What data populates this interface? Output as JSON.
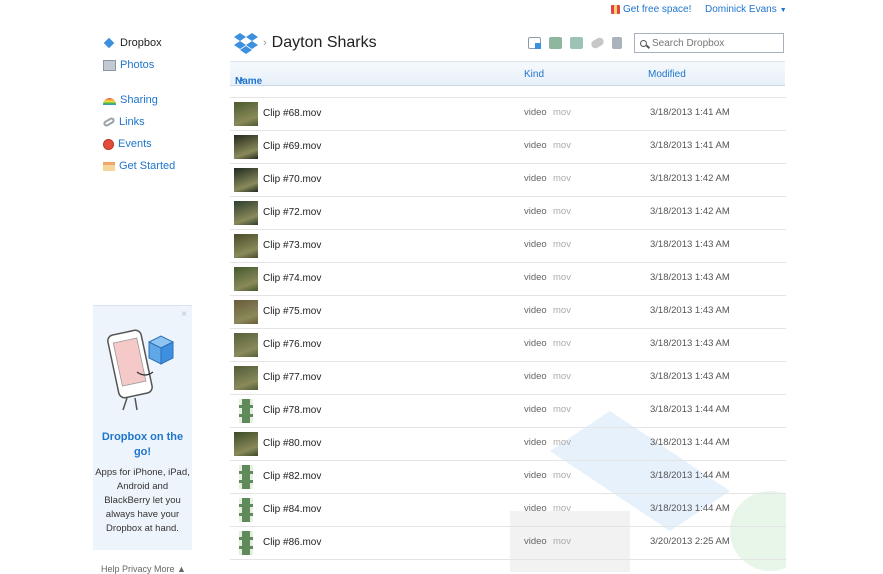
{
  "topbar": {
    "free_space": "Get free space!",
    "user_name": "Dominick Evans",
    "user_caret": "▼"
  },
  "sidebar": {
    "items": [
      {
        "label": "Dropbox",
        "icon": "dropbox-icon",
        "active": true
      },
      {
        "label": "Photos",
        "icon": "photos-icon",
        "active": false
      },
      {
        "label": "Sharing",
        "icon": "sharing-icon",
        "active": false
      },
      {
        "label": "Links",
        "icon": "links-icon",
        "active": false
      },
      {
        "label": "Events",
        "icon": "events-icon",
        "active": false
      },
      {
        "label": "Get Started",
        "icon": "get-started-icon",
        "active": false
      }
    ],
    "promo": {
      "close": "×",
      "title": "Dropbox on the go!",
      "body": "Apps for iPhone, iPad, Android and BlackBerry let you always have your Dropbox at hand."
    },
    "footer": "Help  Privacy  More ▲"
  },
  "header": {
    "breadcrumb_sep": "›",
    "folder_title": "Dayton Sharks",
    "search_placeholder": "Search Dropbox"
  },
  "columns": {
    "name": "Name",
    "sort_indicator": "▲",
    "kind": "Kind",
    "modified": "Modified"
  },
  "files": [
    {
      "name": "Clip #68.mov",
      "kind": "video",
      "ext": "mov",
      "modified": "3/18/2013 1:41 AM",
      "thumb": "photo",
      "color": "#4a5a2e"
    },
    {
      "name": "Clip #69.mov",
      "kind": "video",
      "ext": "mov",
      "modified": "3/18/2013 1:41 AM",
      "thumb": "photo",
      "color": "#23281c"
    },
    {
      "name": "Clip #70.mov",
      "kind": "video",
      "ext": "mov",
      "modified": "3/18/2013 1:42 AM",
      "thumb": "photo",
      "color": "#1f2a22"
    },
    {
      "name": "Clip #72.mov",
      "kind": "video",
      "ext": "mov",
      "modified": "3/18/2013 1:42 AM",
      "thumb": "photo",
      "color": "#2c3d30"
    },
    {
      "name": "Clip #73.mov",
      "kind": "video",
      "ext": "mov",
      "modified": "3/18/2013 1:43 AM",
      "thumb": "photo",
      "color": "#4b4a2a"
    },
    {
      "name": "Clip #74.mov",
      "kind": "video",
      "ext": "mov",
      "modified": "3/18/2013 1:43 AM",
      "thumb": "photo",
      "color": "#43592d"
    },
    {
      "name": "Clip #75.mov",
      "kind": "video",
      "ext": "mov",
      "modified": "3/18/2013 1:43 AM",
      "thumb": "photo",
      "color": "#6a5a3c"
    },
    {
      "name": "Clip #76.mov",
      "kind": "video",
      "ext": "mov",
      "modified": "3/18/2013 1:43 AM",
      "thumb": "photo",
      "color": "#56603a"
    },
    {
      "name": "Clip #77.mov",
      "kind": "video",
      "ext": "mov",
      "modified": "3/18/2013 1:43 AM",
      "thumb": "photo",
      "color": "#4f5c38"
    },
    {
      "name": "Clip #78.mov",
      "kind": "video",
      "ext": "mov",
      "modified": "3/18/2013 1:44 AM",
      "thumb": "film",
      "color": "#5f8a5a"
    },
    {
      "name": "Clip #80.mov",
      "kind": "video",
      "ext": "mov",
      "modified": "3/18/2013 1:44 AM",
      "thumb": "photo",
      "color": "#3a4a26"
    },
    {
      "name": "Clip #82.mov",
      "kind": "video",
      "ext": "mov",
      "modified": "3/18/2013 1:44 AM",
      "thumb": "film",
      "color": "#5f8a5a"
    },
    {
      "name": "Clip #84.mov",
      "kind": "video",
      "ext": "mov",
      "modified": "3/18/2013 1:44 AM",
      "thumb": "film",
      "color": "#5f8a5a"
    },
    {
      "name": "Clip #86.mov",
      "kind": "video",
      "ext": "mov",
      "modified": "3/20/2013 2:25 AM",
      "thumb": "film",
      "color": "#5f8a5a"
    }
  ]
}
